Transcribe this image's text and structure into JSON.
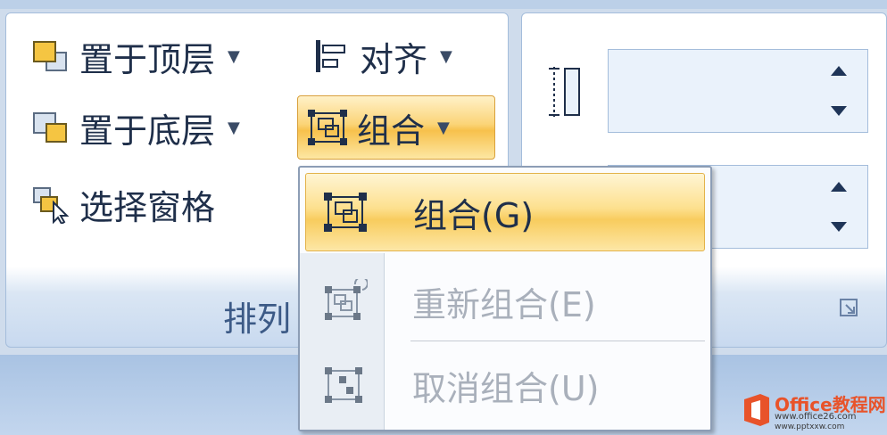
{
  "arrange": {
    "bring_to_front": "置于顶层",
    "align": "对齐",
    "send_to_back": "置于底层",
    "group": "组合",
    "selection_pane": "选择窗格",
    "group_label": "排列"
  },
  "group_menu": {
    "items": [
      {
        "label": "组合(G)",
        "state": "highlighted"
      },
      {
        "label": "重新组合(E)",
        "state": "disabled"
      },
      {
        "label": "取消组合(U)",
        "state": "disabled"
      }
    ]
  },
  "watermark": {
    "brand": "Office教程网",
    "url1": "www.office26.com",
    "url2": "www.pptxxw.com"
  },
  "colors": {
    "highlight": "#f8cc5e",
    "text": "#1f2f4a",
    "disabled_text": "#a9b0bb",
    "group_label": "#3c5a86"
  }
}
